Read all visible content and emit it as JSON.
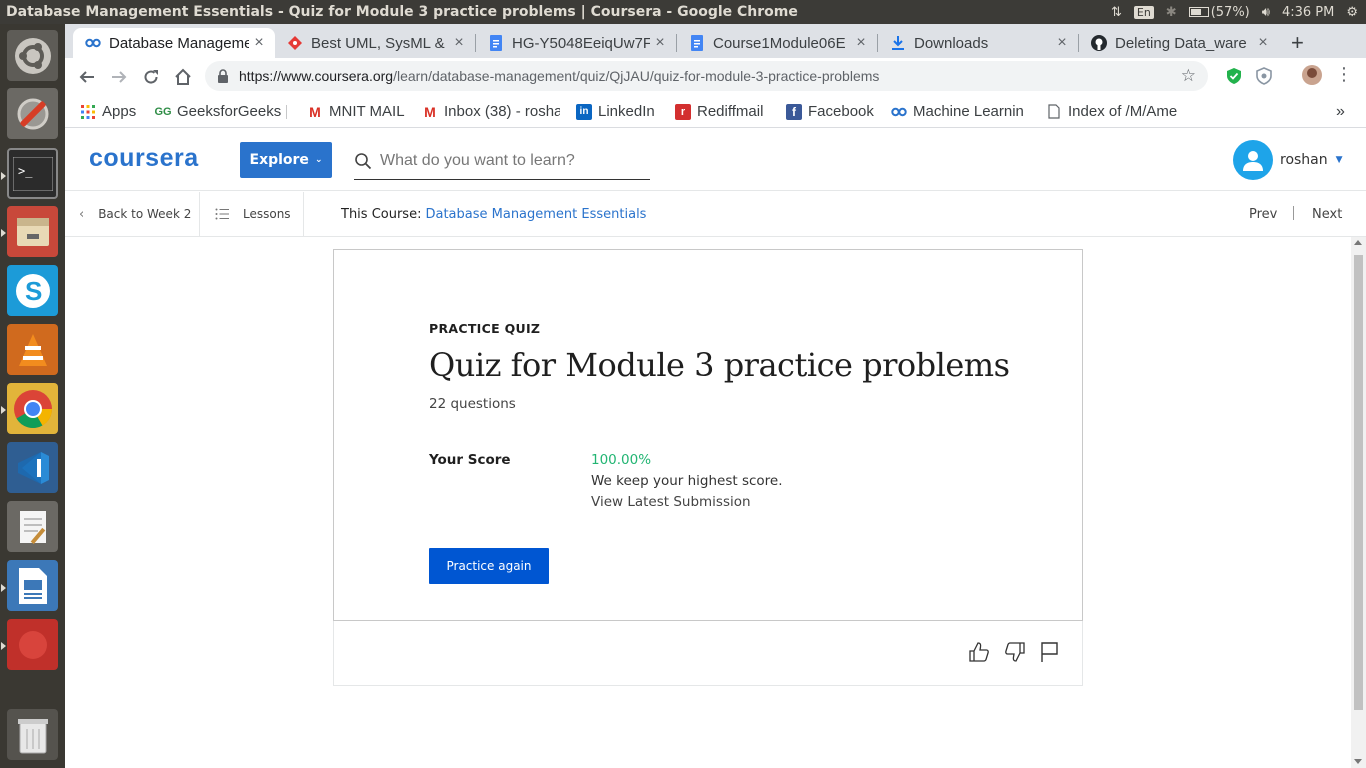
{
  "window": {
    "title": "Database Management Essentials - Quiz for Module 3 practice problems | Coursera - Google Chrome"
  },
  "system_tray": {
    "input_method": "En",
    "battery": "(57%)",
    "time": "4:36 PM"
  },
  "launcher": {
    "items": [
      "ubuntu-dash-icon",
      "system-settings-icon",
      "terminal-icon",
      "file-manager-icon",
      "skype-icon",
      "vlc-icon",
      "chrome-icon",
      "vscode-icon",
      "text-editor-icon",
      "libreoffice-writer-icon",
      "red-app-icon",
      "trash-icon"
    ]
  },
  "tabs": [
    {
      "label": "Database Management Essentials",
      "icon": "coursera-icon",
      "active": true
    },
    {
      "label": "Best UML, SysML & B",
      "icon": "red-diamond-icon",
      "active": false
    },
    {
      "label": "HG-Y5048EeiqUw7F",
      "icon": "docs-icon",
      "active": false
    },
    {
      "label": "Course1Module06E",
      "icon": "docs-icon",
      "active": false
    },
    {
      "label": "Downloads",
      "icon": "download-icon",
      "active": false
    },
    {
      "label": "Deleting Data_ware",
      "icon": "github-icon",
      "active": false
    }
  ],
  "tab_close_glyph": "×",
  "newtab_glyph": "+",
  "address": {
    "host": "https://www.coursera.org",
    "path": "/learn/database-management/quiz/QjJAU/quiz-for-module-3-practice-problems"
  },
  "bookmarks": [
    {
      "label": "Apps",
      "icon": "apps-grid-icon"
    },
    {
      "label": "GeeksforGeeks |",
      "icon": "gfg-icon"
    },
    {
      "label": "MNIT MAIL",
      "icon": "gmail-icon"
    },
    {
      "label": "Inbox (38) - rosha",
      "icon": "gmail-icon"
    },
    {
      "label": "LinkedIn",
      "icon": "linkedin-icon"
    },
    {
      "label": "Rediffmail",
      "icon": "rediff-icon"
    },
    {
      "label": "Facebook",
      "icon": "facebook-icon"
    },
    {
      "label": "Machine Learnin",
      "icon": "coursera-icon"
    },
    {
      "label": "Index of /M/Ame",
      "icon": "page-icon"
    }
  ],
  "bookmarks_overflow": "»",
  "coursera": {
    "logo": "coursera",
    "explore_label": "Explore",
    "search_placeholder": "What do you want to learn?",
    "username": "roshan",
    "brand_color": "#2a73cc"
  },
  "subnav": {
    "back_label": "Back to Week 2",
    "lessons_label": "Lessons",
    "this_course_label": "This Course:",
    "course_name": "Database Management Essentials",
    "prev_label": "Prev",
    "next_label": "Next"
  },
  "quiz": {
    "kicker": "PRACTICE QUIZ",
    "title": "Quiz for Module 3 practice problems",
    "question_count": "22 questions",
    "score_label": "Your Score",
    "score_value": "100.00%",
    "score_color": "#22b573",
    "keep_note": "We keep your highest score.",
    "view_latest": "View Latest Submission",
    "practice_button": "Practice again"
  },
  "feedback_icons": [
    "thumbs-up-icon",
    "thumbs-down-icon",
    "flag-icon"
  ]
}
